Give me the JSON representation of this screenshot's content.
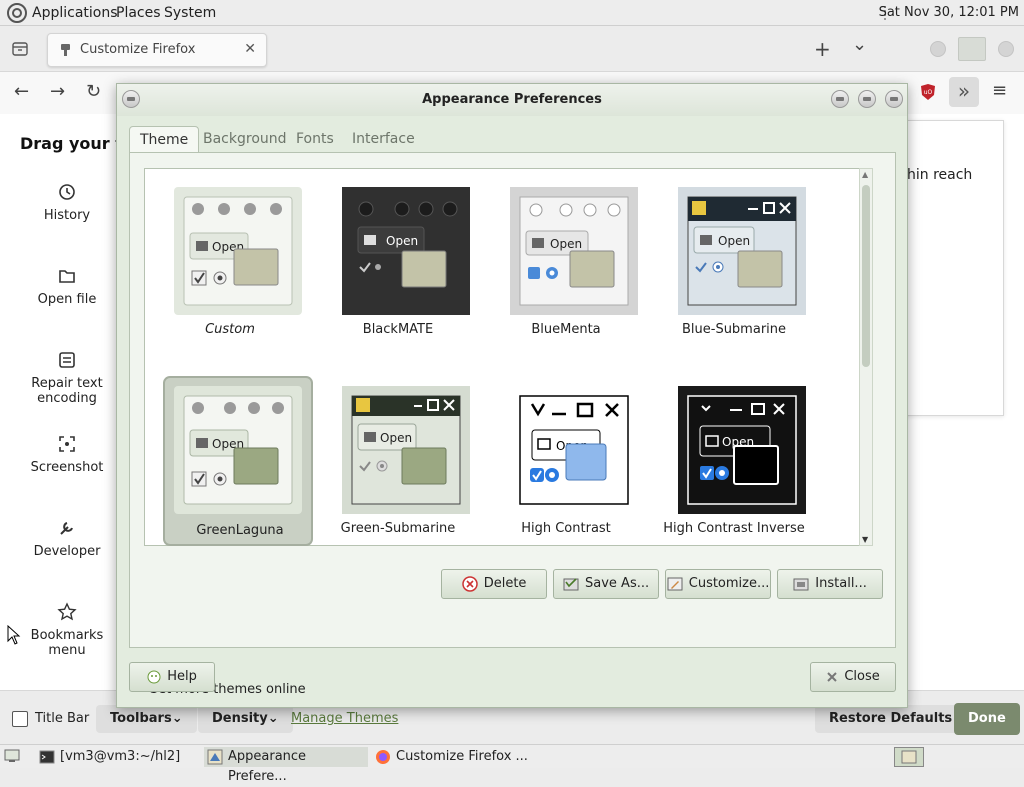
{
  "top_panel": {
    "menus": [
      "Applications",
      "Places",
      "System"
    ],
    "clock": "Sat Nov 30, 12:01 PM"
  },
  "firefox": {
    "tab_title": "Customize Firefox",
    "tab_close": "✕",
    "new_tab": "+",
    "tab_list": "⌄",
    "nav": {
      "back": "←",
      "forward": "→",
      "reload": "↻",
      "overflow": "»",
      "menu": "≡"
    },
    "page": {
      "heading": "Drag your fav",
      "overflow_text": "hin reach",
      "items": [
        {
          "label": "History",
          "icon": "clock-icon"
        },
        {
          "label": "Open file",
          "icon": "folder-icon"
        },
        {
          "label": "Repair text encoding",
          "icon": "text-encoding-icon"
        },
        {
          "label": "Screenshot",
          "icon": "screenshot-icon"
        },
        {
          "label": "Developer",
          "icon": "wrench-icon"
        },
        {
          "label": "Bookmarks menu",
          "icon": "bookmark-star-icon"
        }
      ]
    },
    "bottom": {
      "title_bar": "Title Bar",
      "toolbars": "Toolbars",
      "density": "Density",
      "manage_themes": "Manage Themes",
      "restore_defaults": "Restore Defaults",
      "done": "Done"
    }
  },
  "dialog": {
    "title": "Appearance Preferences",
    "tabs": [
      "Theme",
      "Background",
      "Fonts",
      "Interface"
    ],
    "active_tab": "Theme",
    "themes": [
      {
        "name": "Custom",
        "italic": true
      },
      {
        "name": "BlackMATE"
      },
      {
        "name": "BlueMenta"
      },
      {
        "name": "Blue-Submarine"
      },
      {
        "name": "GreenLaguna",
        "selected": true
      },
      {
        "name": "Green-Submarine"
      },
      {
        "name": "High Contrast"
      },
      {
        "name": "High Contrast Inverse"
      }
    ],
    "thumb_open_label": "Open",
    "buttons": {
      "delete": "Delete",
      "save_as": "Save As...",
      "customize": "Customize...",
      "install": "Install..."
    },
    "get_more": "Get more themes online",
    "help": "Help",
    "close": "Close"
  },
  "taskbar": {
    "items": [
      "[vm3@vm3:~/hl2]",
      "Appearance Prefere...",
      "Customize Firefox ..."
    ]
  },
  "colors": {
    "dialog_bg": "#e3ecdf",
    "accent_green": "#7c8b6f",
    "done_bg": "#7b8a6e"
  }
}
